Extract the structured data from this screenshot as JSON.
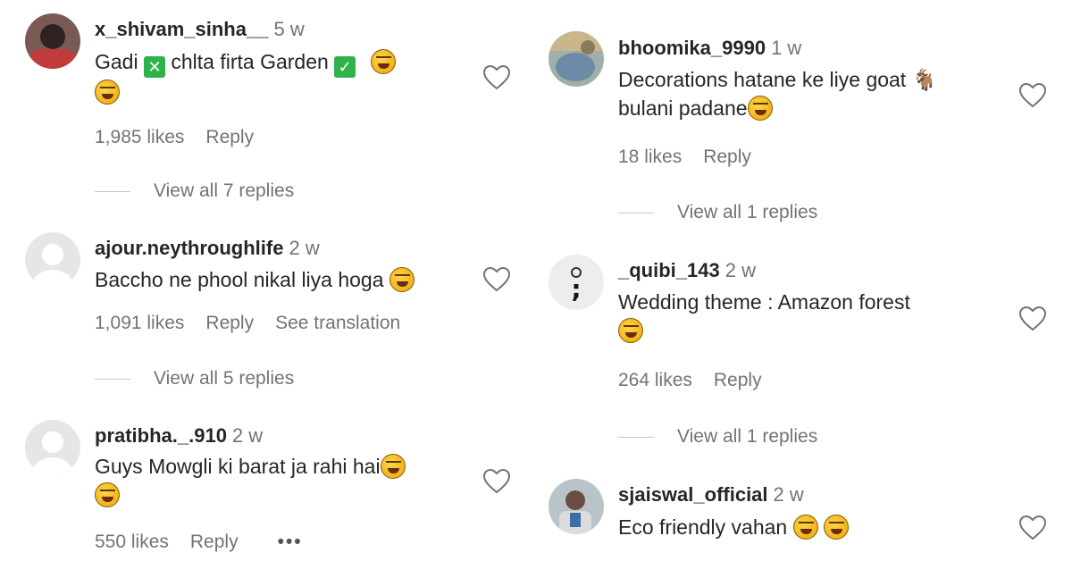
{
  "left_column": [
    {
      "username": "x_shivam_sinha__",
      "time": "5 w",
      "text_parts": [
        "Gadi ",
        " chlta firta Garden "
      ],
      "likes": "1,985 likes",
      "reply": "Reply",
      "view_replies": "View all 7 replies"
    },
    {
      "username": "ajour.neythroughlife",
      "time": "2 w",
      "text_parts": [
        "Baccho ne phool nikal liya hoga "
      ],
      "likes": "1,091 likes",
      "reply": "Reply",
      "translation": "See translation",
      "view_replies": "View all 5 replies"
    },
    {
      "username": "pratibha._.910",
      "time": "2 w",
      "text_parts": [
        "Guys Mowgli ki barat ja rahi hai"
      ],
      "likes": "550 likes",
      "reply": "Reply",
      "more": "•••"
    }
  ],
  "right_column": [
    {
      "username": "bhoomika_9990",
      "time": "1 w",
      "text_parts": [
        "Decorations hatane ke liye goat ",
        " bulani padane"
      ],
      "likes": "18 likes",
      "reply": "Reply",
      "view_replies": "View all 1 replies"
    },
    {
      "username": "_quibi_143",
      "time": "2 w",
      "text_parts": [
        "Wedding theme : Amazon forest"
      ],
      "likes": "264 likes",
      "reply": "Reply",
      "view_replies": "View all 1 replies"
    },
    {
      "username": "sjaiswal_official",
      "time": "2 w",
      "text_parts": [
        "Eco friendly vahan "
      ]
    }
  ],
  "glyphs": {
    "check": "✓",
    "cross": "✕",
    "goat": "🐐",
    "semicolon": ";"
  },
  "colors": {
    "muted": "#737373",
    "text": "#262626",
    "green_box": "#2fb24c"
  }
}
